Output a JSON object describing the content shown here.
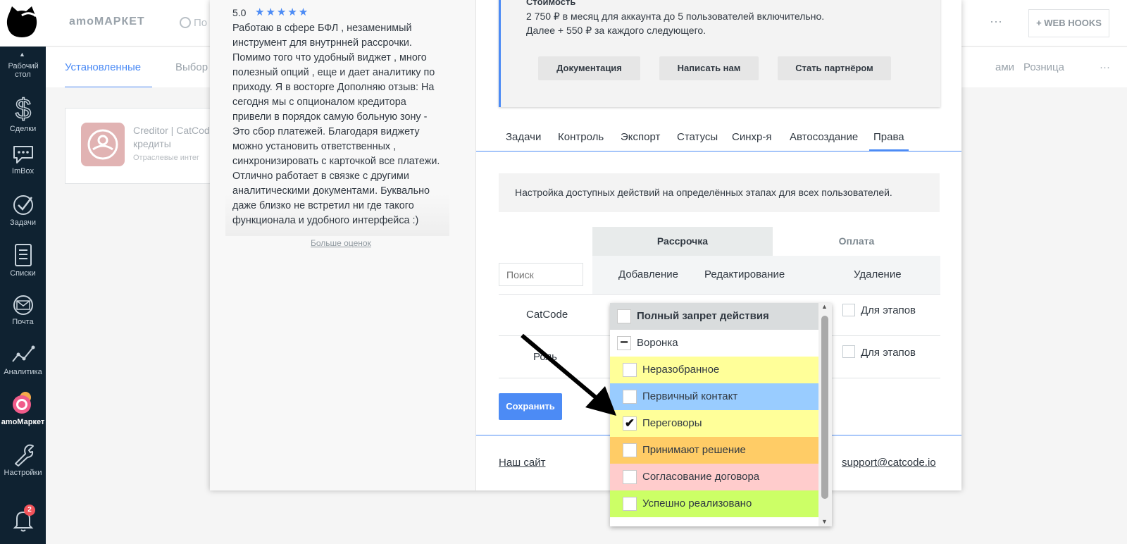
{
  "sidebar": {
    "items": [
      {
        "label": "Рабочий стол"
      },
      {
        "label": "Сделки"
      },
      {
        "label": "ImBox"
      },
      {
        "label": "Задачи"
      },
      {
        "label": "Списки"
      },
      {
        "label": "Почта"
      },
      {
        "label": "Аналитика"
      },
      {
        "label": "amoМаркет"
      },
      {
        "label": "Настройки"
      }
    ],
    "notifications_count": "2"
  },
  "topbar": {
    "brand": "amoМАРКЕТ",
    "search_fragment": "По",
    "more": "···",
    "webhooks_label": "+ WEB HOOKS"
  },
  "bg_tabs": {
    "installed": "Установленные",
    "choice_fragment": "Выбор",
    "email_fragment": "ами",
    "retail": "Розница",
    "more": "···"
  },
  "widget_card": {
    "title_line1": "Creditor | CatCod",
    "title_line2": "кредиты",
    "category": "Отраслевые интег"
  },
  "review": {
    "rating": "5.0",
    "stars": "★★★★★",
    "text": "Работаю в сфере БФЛ , незаменимый инструмент для внутрнней рассрочки. Помимо того что удобный виджет , много полезный опций , еще и дает аналитику по приходу. Я в восторге Дополняю отзыв: На сегодня мы с опционалом кредитора привели в порядок самую больную зону - Это сбор платежей. Благодаря виджету можно установить ответственных , синхронизировать с карточкой все платежи. Отлично работает в связке с другими аналитическими документами. Буквально даже близко не встретил ни где такого функционала и удобного интерфейса :)",
    "more_link": "Больше оценок"
  },
  "price": {
    "heading": "Стоимость",
    "line1": "2 750 ₽ в месяц для аккаунта до 5 пользователей включительно.",
    "line2": "Далее + 550 ₽ за каждого следующего.",
    "buttons": {
      "docs": "Документация",
      "write": "Написать нам",
      "partner": "Стать партнёром"
    }
  },
  "modal_tabs": [
    "Задачи",
    "Контроль",
    "Экспорт",
    "Статусы",
    "Синхр-я",
    "Автосоздание",
    "Права"
  ],
  "active_tab": "Права",
  "notice": "Настройка доступных действий на определённых этапах для всех пользователей.",
  "rights_table": {
    "group_headers": [
      "Рассрочка",
      "Оплата"
    ],
    "columns": [
      "Добавление",
      "Редактирование",
      "Удаление"
    ],
    "search_placeholder": "Поиск",
    "rows": [
      {
        "name": "CatCode",
        "delete_option": "Для этапов"
      },
      {
        "name": "Роль",
        "delete_option": "Для этапов"
      }
    ]
  },
  "save_label": "Сохранить",
  "footer": {
    "our_site": "Наш сайт",
    "support": "support@catcode.io"
  },
  "dropdown": {
    "ban_label": "Полный запрет действия",
    "pipeline": "Воронка",
    "stages": [
      {
        "label": "Неразобранное",
        "color": "#ffff99",
        "checked": false
      },
      {
        "label": "Первичный контакт",
        "color": "#99ccff",
        "checked": false
      },
      {
        "label": "Переговоры",
        "color": "#ffff99",
        "checked": true
      },
      {
        "label": "Принимают решение",
        "color": "#ffcc66",
        "checked": false
      },
      {
        "label": "Согласование договора",
        "color": "#ffcccc",
        "checked": false
      },
      {
        "label": "Успешно реализовано",
        "color": "#ccff66",
        "checked": false
      }
    ]
  },
  "colors": {
    "accent": "#4c8bf5",
    "sidebar_bg": "#0f2231"
  }
}
